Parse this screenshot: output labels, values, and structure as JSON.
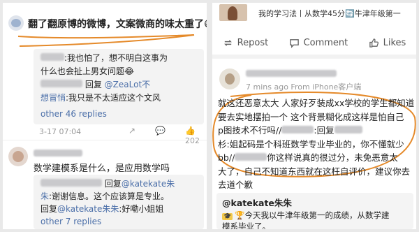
{
  "left": {
    "header_text": "翻了翻原博的微博，文案微商的味太重了",
    "header_emoji": "😷",
    "reply1": {
      "line1_suffix": ":我也怕了，想不明白这事为",
      "line2": "什么也会扯上男女问题",
      "line3_reply": "回复",
      "line3_mention": "@ZeaLot不",
      "line4_mention": "想冒悄",
      "line4_text": ":我只是不太适应这个文风",
      "more": "other 46 replies"
    },
    "time": "3-17 07:04",
    "like_count": "202",
    "comment2_text": "数学建模系是什么，是应用数学吗",
    "reply2": {
      "line1_reply": "回复",
      "line1_mention": "@katekate朱",
      "line2_mention": "朱",
      "line2_text": ":谢谢信息。这个应该算是专业。",
      "line3_reply": "回复",
      "line3_mention": "@katekate朱朱",
      "line3_text": ":好嘞小姐姐",
      "more": "other 7 replies"
    }
  },
  "right": {
    "top_text": "我的学习法丨从数学45分🔄牛津年级第一",
    "actions": {
      "repost": "Repost",
      "comment": "Comment",
      "likes": "Likes"
    },
    "comment": {
      "time": "7 mins ago",
      "source": "From iPhone客户端",
      "body": [
        "就这还恶意太大 人家好歹装成xx学校的学生都知道",
        "要去实地摆拍一个 这个背景糊化成这样是怕自己",
        "p图技术不行吗//",
        "杉:姐起码是个科班数学专业毕业的，你不懂就少",
        "bb//",
        "大了，自己不知道东西就在这枉自评价，建议你去",
        "去道个歉"
      ],
      "body_line3_reply": ":回复",
      "body_line5_text": "你这样说真的很过分，未免恶意太"
    },
    "reply": {
      "name": "@katekate朱朱",
      "line1": "今天我以牛津年级第一的成绩，从数学建",
      "line2": "模系毕业了。"
    }
  }
}
